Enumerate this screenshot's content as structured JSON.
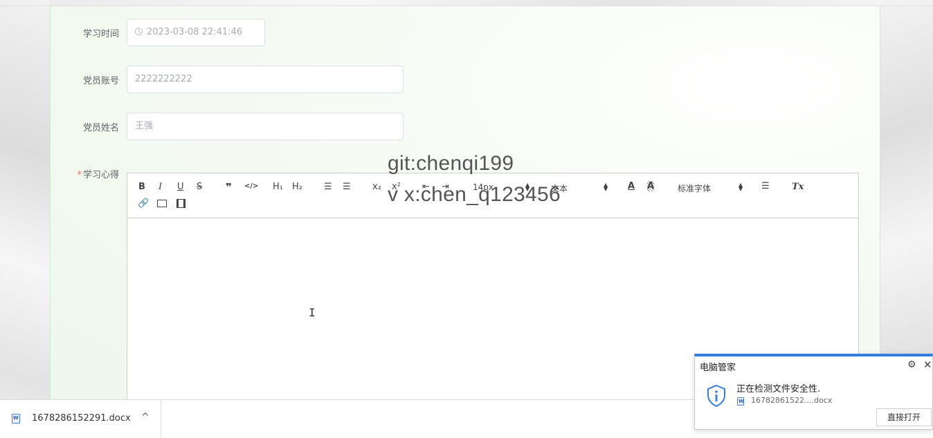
{
  "form": {
    "study_time": {
      "label": "学习时间",
      "value": "2023-03-08 22:41:46"
    },
    "member_account": {
      "label": "党员账号",
      "value": "2222222222"
    },
    "member_name": {
      "label": "党员姓名",
      "value": "王强"
    },
    "study_notes": {
      "required_mark": "*",
      "label": "学习心得"
    }
  },
  "editor": {
    "toolbar": {
      "bold": "B",
      "italic": "I",
      "underline": "U",
      "strike": "S",
      "blockquote": "❞",
      "code": "</>",
      "h1": "H₁",
      "h2": "H₂",
      "ordered_list": "☰",
      "bullet_list": "☰",
      "subscript": "x₂",
      "superscript": "x²",
      "size": "14px",
      "header_select": "文本",
      "font_select": "标准字体",
      "clean": "Tx"
    }
  },
  "watermark": {
    "line1": "git:chenqi199",
    "line2": "v x:chen_q123456"
  },
  "download_bar": {
    "file_name": "1678286152291.docx",
    "chevron": "^"
  },
  "popup": {
    "title": "电脑管家",
    "message": "正在检测文件安全性.",
    "file_name": "16782861522....docx",
    "open_button": "直接打开"
  },
  "colors": {
    "accent": "#2f7de1",
    "required": "#f56c6c",
    "panel_border": "#cfe9cc"
  },
  "icons": [
    "clock-icon",
    "link-icon",
    "image-icon",
    "video-icon",
    "align-icon",
    "color-icon",
    "background-icon",
    "settings-icon",
    "close-icon",
    "shield-info-icon",
    "doc-icon",
    "chevron-up-icon"
  ]
}
